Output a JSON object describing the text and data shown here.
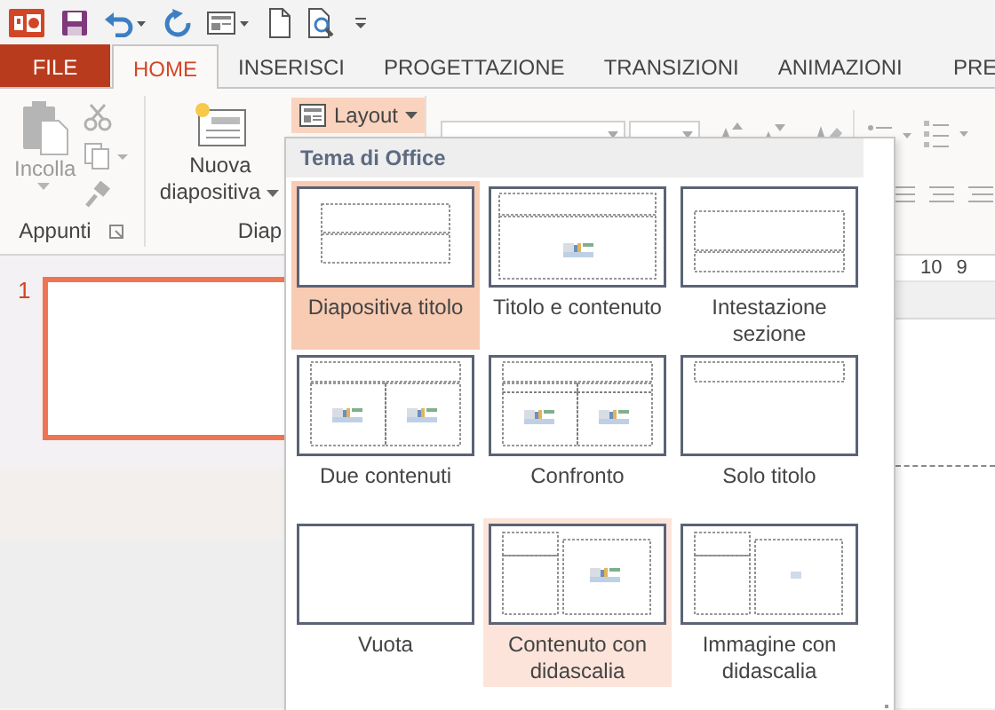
{
  "tabs": [
    {
      "label": "FILE",
      "kind": "file",
      "selected": false
    },
    {
      "label": "HOME",
      "kind": "tab",
      "selected": true
    },
    {
      "label": "INSERISCI",
      "kind": "tab",
      "selected": false
    },
    {
      "label": "PROGETTAZIONE",
      "kind": "tab",
      "selected": false
    },
    {
      "label": "TRANSIZIONI",
      "kind": "tab",
      "selected": false
    },
    {
      "label": "ANIMAZIONI",
      "kind": "tab",
      "selected": false
    },
    {
      "label": "PRE",
      "kind": "tab",
      "selected": false
    }
  ],
  "ribbon": {
    "clipboard": {
      "label": "Appunti",
      "paste": {
        "label": "Incolla",
        "disabled": true
      }
    },
    "slides_group": {
      "label": "Diap",
      "new_slide": {
        "line1": "Nuova",
        "line2": "diapositiva"
      },
      "layout": {
        "label": "Layout",
        "open": true
      }
    }
  },
  "layout_menu": {
    "header": "Tema di Office",
    "items": [
      {
        "label": "Diapositiva titolo",
        "kind": "title",
        "selected": true,
        "hovered": false
      },
      {
        "label": "Titolo e contenuto",
        "kind": "title-content",
        "selected": false,
        "hovered": false
      },
      {
        "label": "Intestazione sezione",
        "kind": "section",
        "selected": false,
        "hovered": false
      },
      {
        "label": "Due contenuti",
        "kind": "two-content",
        "selected": false,
        "hovered": false
      },
      {
        "label": "Confronto",
        "kind": "comparison",
        "selected": false,
        "hovered": false
      },
      {
        "label": "Solo titolo",
        "kind": "title-only",
        "selected": false,
        "hovered": false
      },
      {
        "label": "Vuota",
        "kind": "blank",
        "selected": false,
        "hovered": false
      },
      {
        "label": "Contenuto con didascalia",
        "kind": "content-caption",
        "selected": false,
        "hovered": true
      },
      {
        "label": "Immagine con didascalia",
        "kind": "picture-caption",
        "selected": false,
        "hovered": false
      }
    ]
  },
  "ruler": [
    "10",
    "9"
  ],
  "slides": [
    {
      "number": "1",
      "selected": true
    }
  ]
}
